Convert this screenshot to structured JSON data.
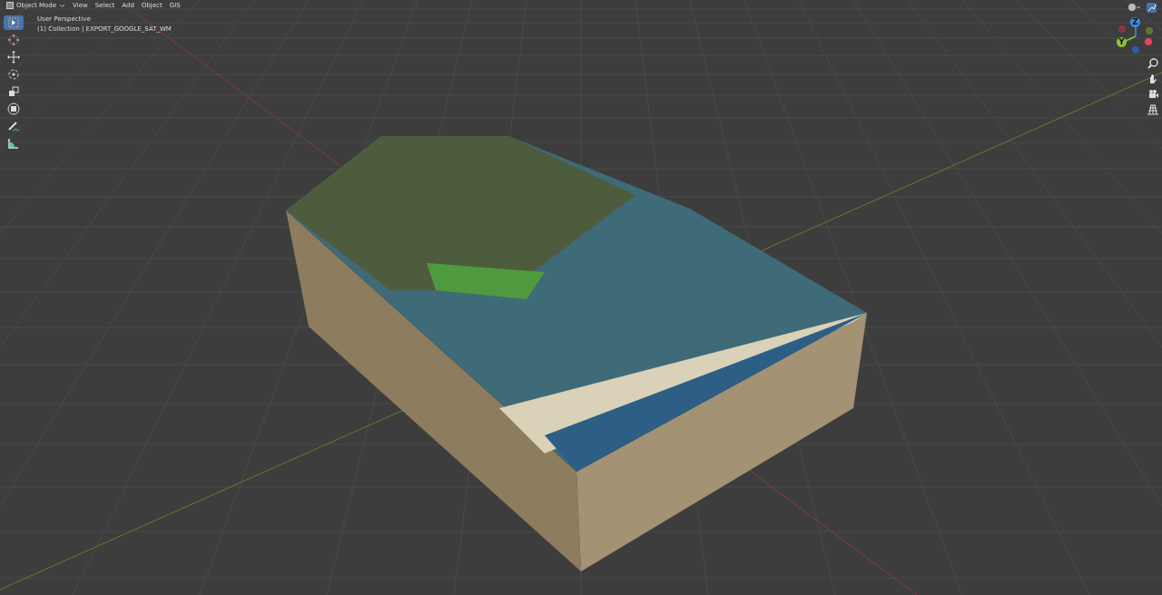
{
  "header": {
    "mode": "Object Mode",
    "menus": [
      "View",
      "Select",
      "Add",
      "Object",
      "GIS"
    ]
  },
  "viewport": {
    "view_name": "User Perspective",
    "collection": "(1) Collection | EXPORT_GOOGLE_SAT_WM"
  },
  "tools": [
    {
      "kind": "select",
      "selected": true
    },
    {
      "kind": "cursor",
      "selected": false
    },
    {
      "kind": "move",
      "selected": false
    },
    {
      "kind": "rotate",
      "selected": false
    },
    {
      "kind": "scale",
      "selected": false
    },
    {
      "kind": "transform",
      "selected": false
    },
    {
      "kind": "annotate",
      "selected": false
    },
    {
      "kind": "measure",
      "selected": false
    }
  ],
  "gizmo": {
    "z_label": "Z",
    "y_label": "Y"
  }
}
